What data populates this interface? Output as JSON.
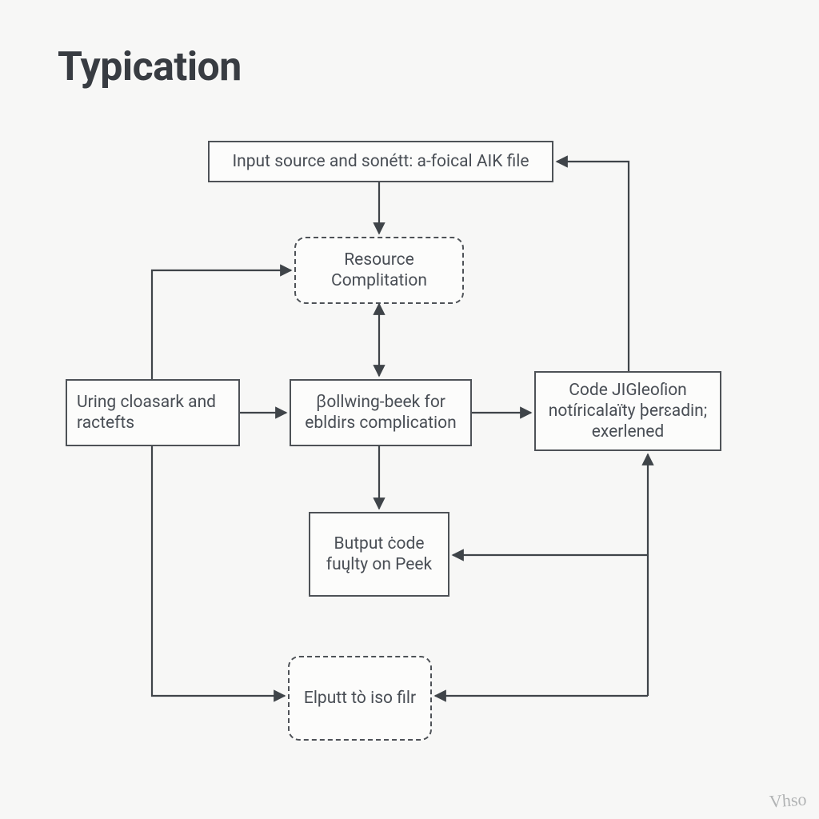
{
  "title": "Typication",
  "nodes": {
    "input": "Input source and sonétt: a-foical AIK file",
    "resource": "Resource Complitation",
    "uring": "Uring cloasark and ractefts",
    "following": "ꞵollwing-beek for ebldirs complication",
    "code": "Code JIGleoſion notíricalaïty þerɛadin; exerlened",
    "butput": "Butput ċode fuųlty on Peek",
    "elputt": "Elputt tò iso filr"
  },
  "watermark": "Vhso"
}
